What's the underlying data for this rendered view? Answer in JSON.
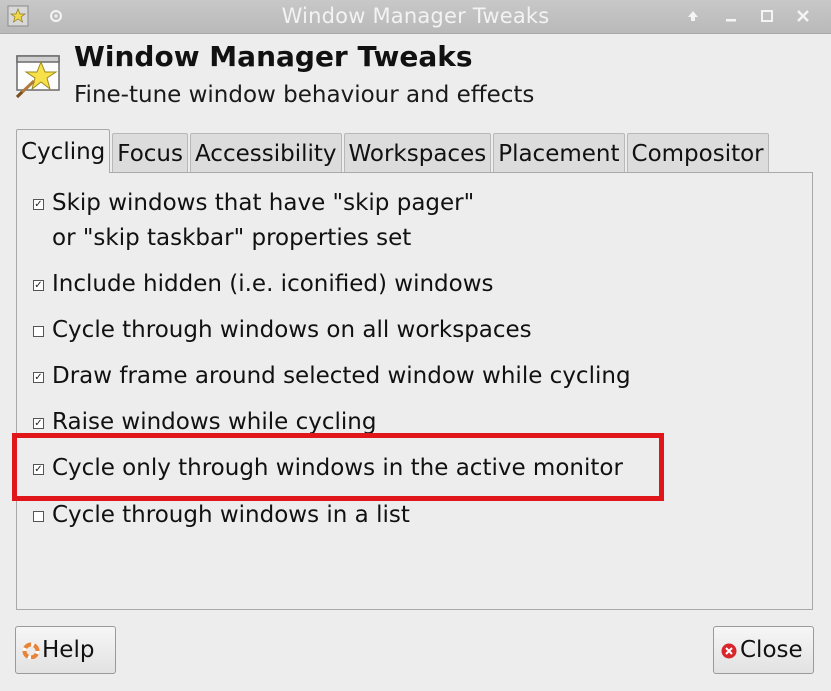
{
  "window": {
    "title": "Window Manager Tweaks"
  },
  "header": {
    "title": "Window Manager Tweaks",
    "subtitle": "Fine-tune window behaviour and effects"
  },
  "tabs": [
    {
      "label": "Cycling",
      "active": true
    },
    {
      "label": "Focus",
      "active": false
    },
    {
      "label": "Accessibility",
      "active": false
    },
    {
      "label": "Workspaces",
      "active": false
    },
    {
      "label": "Placement",
      "active": false
    },
    {
      "label": "Compositor",
      "active": false
    }
  ],
  "options": [
    {
      "line1": "Skip windows that have \"skip pager\"",
      "line2": "or \"skip taskbar\" properties set",
      "checked": true
    },
    {
      "line1": "Include hidden (i.e. iconified) windows",
      "checked": true
    },
    {
      "line1": "Cycle through windows on all workspaces",
      "checked": false
    },
    {
      "line1": "Draw frame around selected window while cycling",
      "checked": true
    },
    {
      "line1": "Raise windows while cycling",
      "checked": true
    },
    {
      "line1": "Cycle only through windows in the active monitor",
      "checked": true
    },
    {
      "line1": "Cycle through windows in a list",
      "checked": false
    }
  ],
  "buttons": {
    "help_label": "Help",
    "close_label": "Close"
  },
  "icons": {
    "app": "star-wand-icon",
    "help": "lifebuoy-icon",
    "close": "close-circle-icon"
  },
  "colors": {
    "highlight": "#e0161b",
    "titlebar": "#bfbfbf",
    "background": "#ededed"
  }
}
